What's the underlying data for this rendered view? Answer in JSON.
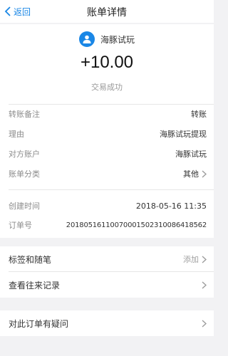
{
  "nav": {
    "back_label": "返回",
    "title": "账单详情"
  },
  "bill": {
    "counterparty": "海豚试玩",
    "amount": "+10.00",
    "status": "交易成功"
  },
  "details": [
    {
      "label": "转账备注",
      "value": "转账"
    },
    {
      "label": "理由",
      "value": "海豚试玩提现"
    },
    {
      "label": "对方账户",
      "value": "海豚试玩"
    },
    {
      "label": "账单分类",
      "value": "其他"
    }
  ],
  "meta": [
    {
      "label": "创建时间",
      "value": "2018-05-16 11:35"
    },
    {
      "label": "订单号",
      "value": "20180516110070001502310086418562"
    }
  ],
  "actions": [
    {
      "label": "标签和随笔",
      "right": "添加"
    },
    {
      "label": "查看往来记录",
      "right": ""
    }
  ],
  "help": {
    "label": "对此订单有疑问"
  },
  "colors": {
    "accent": "#1a87e6",
    "background": "#f2f2f4"
  }
}
